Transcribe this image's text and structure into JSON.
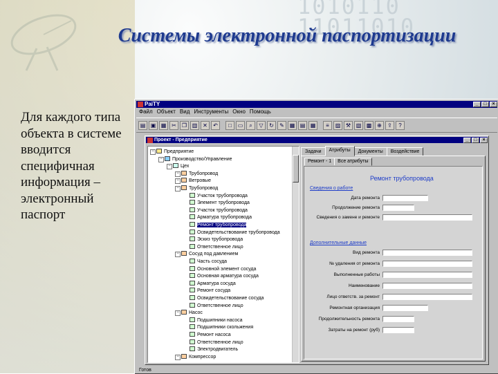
{
  "slide": {
    "title": "Системы электронной паспортизации",
    "body": "Для каждого типа объекта в системе вводится специфичная информация – электронный паспорт",
    "decor_digits": "1010110\n11011010"
  },
  "app": {
    "title": "PaiTY",
    "menu": [
      "Файл",
      "Объект",
      "Вид",
      "Инструменты",
      "Окно",
      "Помощь"
    ],
    "toolbar_icons": [
      "open-icon",
      "save-icon",
      "print-icon",
      "cut-icon",
      "copy-icon",
      "paste-icon",
      "delete-icon",
      "undo-icon",
      "new-icon",
      "folder-icon",
      "find-icon",
      "filter-icon",
      "refresh-icon",
      "edit-icon",
      "form-icon",
      "report-icon",
      "grid-icon",
      "list-icon",
      "chart-icon",
      "tool-icon",
      "map-icon",
      "layers-icon",
      "zoom-icon",
      "export-icon",
      "help-icon"
    ],
    "status": "Готов",
    "child": {
      "title": "Проект - Предприятие",
      "tree": [
        {
          "label": "Предприятие",
          "level": 0
        },
        {
          "label": "Производство/Управление",
          "level": 1
        },
        {
          "label": "Цех",
          "level": 2
        },
        {
          "label": "Трубопровод",
          "level": 3
        },
        {
          "label": "Ветровые",
          "level": 3
        },
        {
          "label": "Трубопровод",
          "level": 3
        },
        {
          "label": "Участок трубопровода",
          "level": 4
        },
        {
          "label": "Элемент трубопровода",
          "level": 4
        },
        {
          "label": "Участок трубопровода",
          "level": 4
        },
        {
          "label": "Арматура трубопровода",
          "level": 4
        },
        {
          "label": "Ремонт трубопровода",
          "level": 4,
          "selected": true
        },
        {
          "label": "Освидетельствование трубопровода",
          "level": 4
        },
        {
          "label": "Эскиз трубопровода",
          "level": 4
        },
        {
          "label": "Ответственное лицо",
          "level": 4
        },
        {
          "label": "Сосуд под давлением",
          "level": 3
        },
        {
          "label": "Часть сосуда",
          "level": 4
        },
        {
          "label": "Основной элемент сосуда",
          "level": 4
        },
        {
          "label": "Основная арматура сосуда",
          "level": 4
        },
        {
          "label": "Арматура сосуда",
          "level": 4
        },
        {
          "label": "Ремонт сосуда",
          "level": 4
        },
        {
          "label": "Освидетельствование сосуда",
          "level": 4
        },
        {
          "label": "Ответственное лицо",
          "level": 4
        },
        {
          "label": "Насос",
          "level": 3
        },
        {
          "label": "Подшипники насоса",
          "level": 4
        },
        {
          "label": "Подшипники скольжения",
          "level": 4
        },
        {
          "label": "Ремонт насоса",
          "level": 4
        },
        {
          "label": "Ответственное лицо",
          "level": 4
        },
        {
          "label": "Электродвигатель",
          "level": 4
        },
        {
          "label": "Компрессор",
          "level": 3
        }
      ],
      "tabs": [
        "Задачи",
        "Атрибуты",
        "Документы",
        "Воздействие"
      ],
      "active_tab": "Атрибуты",
      "subtabs": [
        "Ремонт - 1",
        "Все атрибуты"
      ],
      "form": {
        "heading": "Ремонт трубопровода",
        "section1": "Сведения о работе",
        "fields1": [
          {
            "label": "Дата ремонта",
            "value": ""
          },
          {
            "label": "Продолжение ремонта",
            "value": ""
          },
          {
            "label": "Сведения о замене и ремонте",
            "value": ""
          }
        ],
        "section2": "Дополнительные данные",
        "fields2": [
          {
            "label": "Вид ремонта",
            "value": ""
          },
          {
            "label": "№ удаления от ремонта",
            "value": ""
          },
          {
            "label": "Выполненные работы",
            "value": ""
          },
          {
            "label": "Наименование",
            "value": ""
          },
          {
            "label": "Лицо ответств. за ремонт",
            "value": ""
          },
          {
            "label": "Ремонтная организация",
            "value": ""
          },
          {
            "label": "Продолжительность ремонта",
            "value": ""
          },
          {
            "label": "Затраты на ремонт (руб)",
            "value": ""
          }
        ]
      }
    }
  }
}
